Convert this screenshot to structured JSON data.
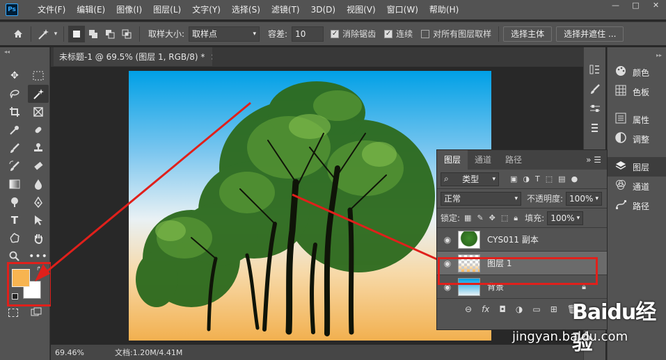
{
  "app": {
    "logo": "Ps"
  },
  "menubar": {
    "items": [
      "文件(F)",
      "编辑(E)",
      "图像(I)",
      "图层(L)",
      "文字(Y)",
      "选择(S)",
      "滤镜(T)",
      "3D(D)",
      "视图(V)",
      "窗口(W)",
      "帮助(H)"
    ]
  },
  "window_controls": {
    "minimize": "—",
    "maximize": "□",
    "close": "✕"
  },
  "options": {
    "sample_size_label": "取样大小:",
    "sample_size_value": "取样点",
    "tolerance_label": "容差:",
    "tolerance_value": "10",
    "antialias_label": "消除锯齿",
    "contiguous_label": "连续",
    "all_layers_label": "对所有图层取样",
    "select_subject": "选择主体",
    "select_mask": "选择并遮住 ..."
  },
  "document": {
    "tab_title": "未标题-1 @ 69.5% (图层 1, RGB/8) *",
    "tab_close": "×"
  },
  "status": {
    "zoom": "69.46%",
    "doc_info": "文档:1.20M/4.41M"
  },
  "right_dock": {
    "items": [
      {
        "icon": "palette-icon",
        "label": "颜色"
      },
      {
        "icon": "grid-icon",
        "label": "色板"
      },
      {
        "icon": "properties-icon",
        "label": "属性"
      },
      {
        "icon": "adjust-icon",
        "label": "调整"
      },
      {
        "icon": "layers-icon",
        "label": "图层"
      },
      {
        "icon": "channels-icon",
        "label": "通道"
      },
      {
        "icon": "paths-icon",
        "label": "路径"
      }
    ]
  },
  "layers_panel": {
    "tabs": [
      "图层",
      "通道",
      "路径"
    ],
    "filter_type": "类型",
    "blend_mode": "正常",
    "opacity_label": "不透明度:",
    "opacity_value": "100%",
    "lock_label": "锁定:",
    "fill_label": "填充:",
    "fill_value": "100%",
    "layers": [
      {
        "name": "CYS011 副本",
        "selected": false
      },
      {
        "name": "图层 1",
        "selected": true
      },
      {
        "name": "背景",
        "selected": false
      }
    ],
    "bottom_fx": "fx"
  },
  "watermark": {
    "brand": "Baidu经验",
    "url": "jingyan.baidu.com"
  },
  "colors": {
    "foreground": "#f7b450",
    "background": "#ffffff",
    "annotation": "#e0201b"
  }
}
